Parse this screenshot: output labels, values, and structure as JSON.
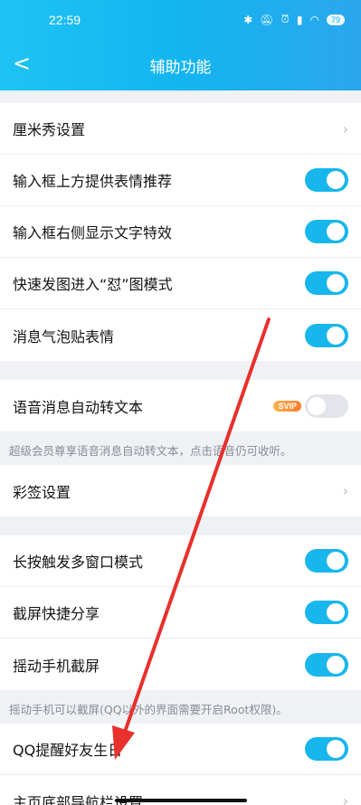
{
  "status": {
    "time": "22:59",
    "battery": "79"
  },
  "header": {
    "back": "<",
    "title": "辅助功能"
  },
  "section1": [
    {
      "label": "厘米秀设置",
      "control": "chevron"
    },
    {
      "label": "输入框上方提供表情推荐",
      "control": "toggle",
      "on": true
    },
    {
      "label": "输入框右侧显示文字特效",
      "control": "toggle",
      "on": true
    },
    {
      "label": "快速发图进入“怼”图模式",
      "control": "toggle",
      "on": true
    },
    {
      "label": "消息气泡贴表情",
      "control": "toggle",
      "on": true
    }
  ],
  "section2": {
    "label": "语音消息自动转文本",
    "badge": "SVIP",
    "on": false,
    "hint": "超级会员尊享语音消息自动转文本，点击语音仍可收听。"
  },
  "section3": {
    "label": "彩签设置"
  },
  "section4": [
    {
      "label": "长按触发多窗口模式",
      "on": true
    },
    {
      "label": "截屏快捷分享",
      "on": true
    },
    {
      "label": "摇动手机截屏",
      "on": true
    }
  ],
  "section4_hint": "摇动手机可以截屏(QQ以外的界面需要开启Root权限)。",
  "section5": [
    {
      "label": "QQ提醒好友生日",
      "control": "toggle",
      "on": true
    },
    {
      "label": "主页底部导航栏设置",
      "control": "chevron"
    }
  ],
  "icons": {
    "chevron": "›",
    "accent": "#17b6ed",
    "arrow_color": "#e8302c"
  }
}
